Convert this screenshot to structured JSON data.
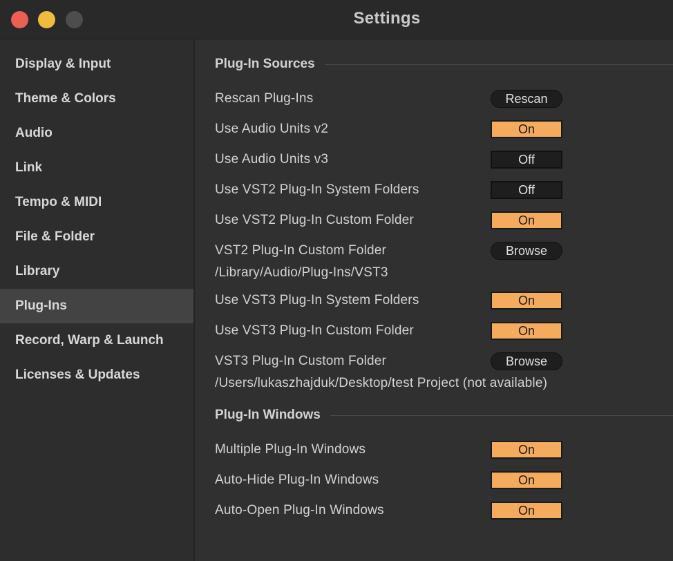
{
  "window": {
    "title": "Settings"
  },
  "sidebar": {
    "items": [
      {
        "label": "Display & Input",
        "active": false
      },
      {
        "label": "Theme & Colors",
        "active": false
      },
      {
        "label": "Audio",
        "active": false
      },
      {
        "label": "Link",
        "active": false
      },
      {
        "label": "Tempo & MIDI",
        "active": false
      },
      {
        "label": "File & Folder",
        "active": false
      },
      {
        "label": "Library",
        "active": false
      },
      {
        "label": "Plug-Ins",
        "active": true
      },
      {
        "label": "Record, Warp & Launch",
        "active": false
      },
      {
        "label": "Licenses & Updates",
        "active": false
      }
    ]
  },
  "sources": {
    "heading": "Plug-In Sources",
    "rescan": {
      "label": "Rescan Plug-Ins",
      "button": "Rescan"
    },
    "au_v2": {
      "label": "Use Audio Units v2",
      "value": "On"
    },
    "au_v3": {
      "label": "Use Audio Units v3",
      "value": "Off"
    },
    "vst2_system": {
      "label": "Use VST2 Plug-In System Folders",
      "value": "Off"
    },
    "vst2_custom": {
      "label": "Use VST2 Plug-In Custom Folder",
      "value": "On"
    },
    "vst2_folder": {
      "label": "VST2 Plug-In Custom Folder",
      "button": "Browse",
      "path": "/Library/Audio/Plug-Ins/VST3"
    },
    "vst3_system": {
      "label": "Use VST3 Plug-In System Folders",
      "value": "On"
    },
    "vst3_custom": {
      "label": "Use VST3 Plug-In Custom Folder",
      "value": "On"
    },
    "vst3_folder": {
      "label": "VST3 Plug-In Custom Folder",
      "button": "Browse",
      "path": "/Users/lukaszhajduk/Desktop/test Project (not available)"
    }
  },
  "windows": {
    "heading": "Plug-In Windows",
    "multiple": {
      "label": "Multiple Plug-In Windows",
      "value": "On"
    },
    "auto_hide": {
      "label": "Auto-Hide Plug-In Windows",
      "value": "On"
    },
    "auto_open": {
      "label": "Auto-Open Plug-In Windows",
      "value": "On"
    }
  },
  "colors": {
    "toggle_on": "#f5ab5e",
    "toggle_off": "#1e1e1e",
    "close": "#ec5f57",
    "minimize": "#f0bb41",
    "zoom": "#4d4d4d"
  }
}
